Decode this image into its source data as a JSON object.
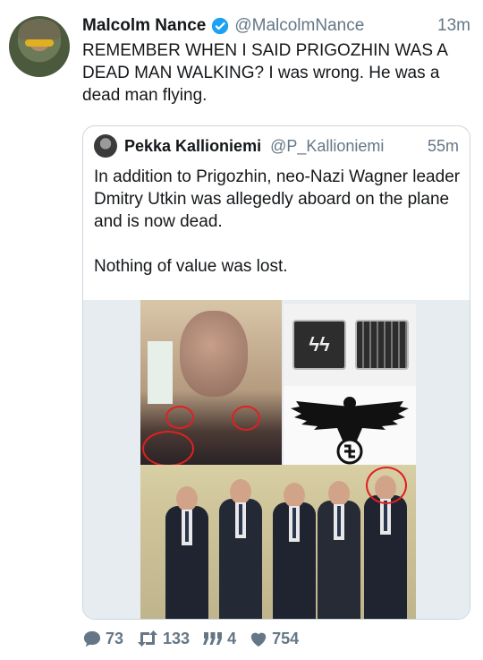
{
  "tweet": {
    "author_name": "Malcolm Nance",
    "author_handle": "@MalcolmNance",
    "time": "13m",
    "text": "REMEMBER WHEN I SAID PRIGOZHIN WAS A DEAD MAN WALKING? I was wrong. He was a dead man flying."
  },
  "quoted_tweet": {
    "author_name": "Pekka Kallioniemi",
    "author_handle": "@P_Kallioniemi",
    "time": "55m",
    "paragraph_1": "In addition to Prigozhin, neo-Nazi Wagner leader Dmitry Utkin was allegedly aboard on the plane and is now dead.",
    "paragraph_2": "Nothing of value was lost."
  },
  "actions": {
    "replies": "73",
    "retweets": "133",
    "quotes": "4",
    "likes": "754"
  },
  "colors": {
    "verified": "#1da1f2",
    "secondary_text": "#657786",
    "annotation_circle": "#e02020"
  },
  "icons": {
    "verified": "verified-badge-icon",
    "reply": "reply-icon",
    "retweet": "retweet-icon",
    "quote": "quote-icon",
    "like": "heart-icon"
  }
}
